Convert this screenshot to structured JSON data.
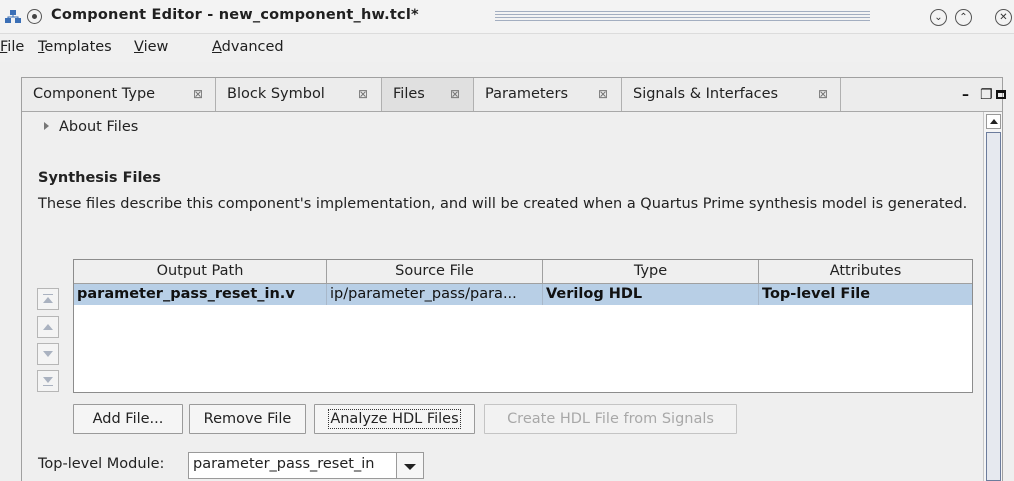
{
  "window": {
    "title": "Component Editor - new_component_hw.tcl*"
  },
  "menubar": {
    "items": [
      {
        "mnemonic": "F",
        "rest": "ile"
      },
      {
        "mnemonic": "T",
        "rest": "emplates"
      },
      {
        "mnemonic": "V",
        "rest": "iew"
      },
      {
        "mnemonic": "A",
        "rest": "dvanced"
      }
    ]
  },
  "tabs": [
    {
      "label": "Component Type",
      "close": "⊠"
    },
    {
      "label": "Block Symbol",
      "close": "⊠"
    },
    {
      "label": "Files",
      "close": "⊠",
      "active": true
    },
    {
      "label": "Parameters",
      "close": "⊠"
    },
    {
      "label": "Signals & Interfaces",
      "close": "⊠"
    }
  ],
  "tab_controls": {
    "minimize": "–",
    "maximize": "❐"
  },
  "about_files": {
    "label": "About Files"
  },
  "synthesis": {
    "title": "Synthesis Files",
    "description": "These files describe this component's implementation, and will be created when a Quartus Prime synthesis model is generated."
  },
  "files_table": {
    "columns": [
      "Output Path",
      "Source File",
      "Type",
      "Attributes"
    ],
    "rows": [
      {
        "output_path": "parameter_pass_reset_in.v",
        "source_file": "ip/parameter_pass/para...",
        "type": "Verilog HDL",
        "attributes": "Top-level File",
        "selected": true
      }
    ]
  },
  "buttons": {
    "add_file": "Add File...",
    "remove_file": "Remove File",
    "analyze_hdl": "Analyze HDL Files",
    "create_hdl": "Create HDL File from Signals"
  },
  "top_level_module": {
    "label": "Top-level Module:",
    "value": "parameter_pass_reset_in"
  },
  "colors": {
    "selection": "#b8cfe6",
    "scroll_thumb_border": "#6c7c9c"
  }
}
